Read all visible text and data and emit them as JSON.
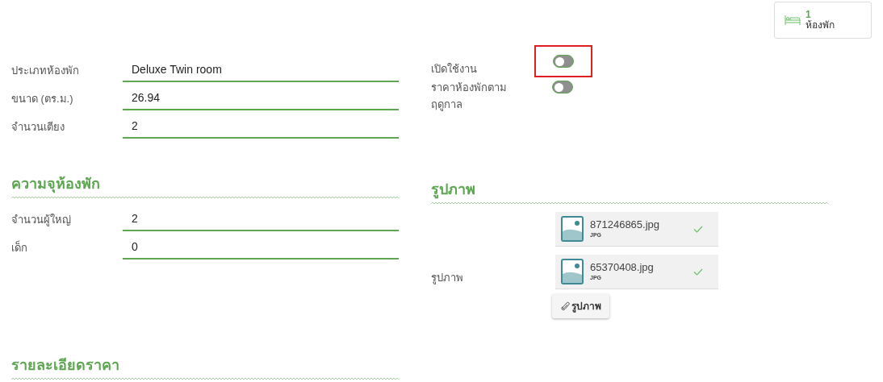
{
  "room_summary": {
    "count": "1",
    "label": "ห้องพัก"
  },
  "room_fields": [
    {
      "label": "ประเภทห้องพัก",
      "value": "Deluxe Twin room"
    },
    {
      "label": "ขนาด (ตร.ม.)",
      "value": "26.94"
    },
    {
      "label": "จำนวนเตียง",
      "value": "2"
    }
  ],
  "toggles": [
    {
      "label": "เปิดใช้งาน",
      "on": false,
      "highlighted": true
    },
    {
      "label": "ราคาห้องพักตามฤดูกาล",
      "on": false,
      "highlighted": false
    }
  ],
  "capacity": {
    "heading": "ความจุห้องพัก",
    "fields": [
      {
        "label": "จำนวนผู้ใหญ่",
        "value": "2"
      },
      {
        "label": "เด็ก",
        "value": "0"
      }
    ]
  },
  "images": {
    "heading": "รูปภาพ",
    "label": "รูปภาพ",
    "files": [
      {
        "name": "871246865.jpg",
        "type": "JPG",
        "uploaded": true
      },
      {
        "name": "65370408.jpg",
        "type": "JPG",
        "uploaded": true
      }
    ],
    "button": "รูปภาพ"
  },
  "price_details": {
    "heading": "รายละเอียดราคา"
  }
}
